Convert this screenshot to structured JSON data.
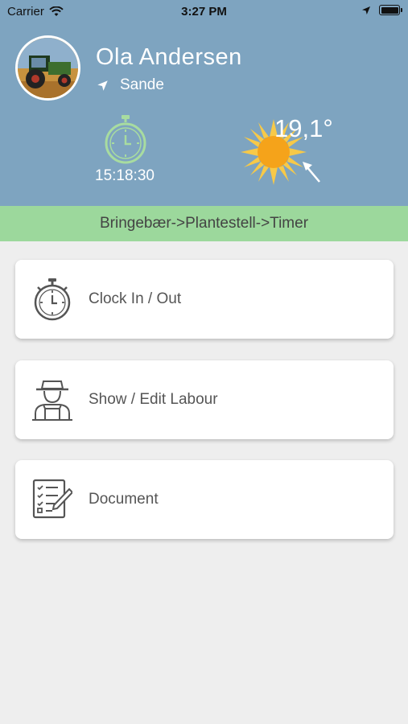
{
  "status_bar": {
    "carrier": "Carrier",
    "time": "3:27 PM"
  },
  "user": {
    "name": "Ola Andersen",
    "location": "Sande"
  },
  "clock": {
    "time": "15:18:30"
  },
  "weather": {
    "temperature": "19,1°"
  },
  "breadcrumb": "Bringebær->Plantestell->Timer",
  "menu": [
    {
      "label": "Clock In / Out",
      "icon": "stopwatch-icon"
    },
    {
      "label": "Show / Edit Labour",
      "icon": "farmer-icon"
    },
    {
      "label": "Document",
      "icon": "checklist-icon"
    }
  ],
  "colors": {
    "header": "#7ea4c0",
    "breadcrumb_bg": "#9cd89c",
    "stopwatch": "#a8dca0",
    "sun": "#f5a31a"
  }
}
